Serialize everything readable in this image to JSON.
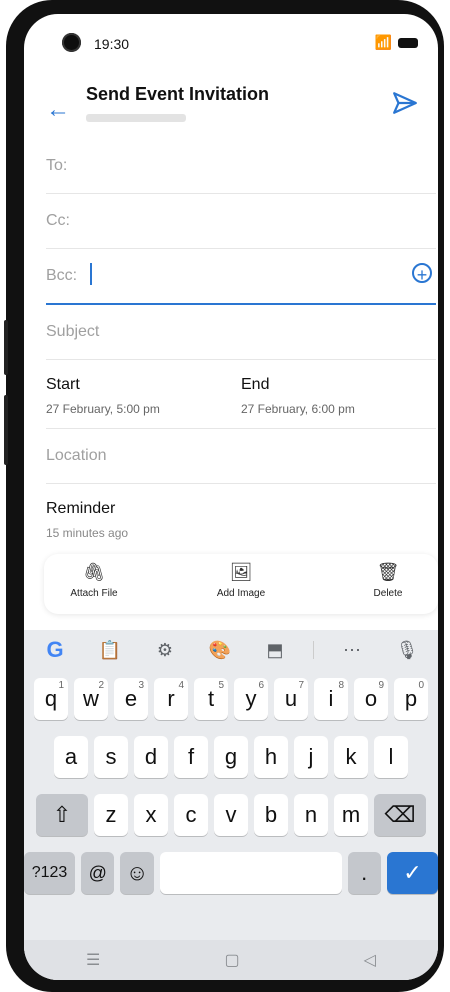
{
  "status": {
    "time": "19:30"
  },
  "header": {
    "title": "Send Event Invitation"
  },
  "form": {
    "to_label": "To:",
    "cc_label": "Cc:",
    "bcc_label": "Bcc:",
    "subject_placeholder": "Subject",
    "start_label": "Start",
    "start_value": "27 February, 5:00 pm",
    "end_label": "End",
    "end_value": "27 February, 6:00 pm",
    "location_placeholder": "Location",
    "reminder_label": "Reminder",
    "reminder_value": "15 minutes ago"
  },
  "actions": {
    "attach": "Attach File",
    "image": "Add Image",
    "delete": "Delete"
  },
  "keyboard": {
    "row1": [
      {
        "char": "q",
        "num": "1"
      },
      {
        "char": "w",
        "num": "2"
      },
      {
        "char": "e",
        "num": "3"
      },
      {
        "char": "r",
        "num": "4"
      },
      {
        "char": "t",
        "num": "5"
      },
      {
        "char": "y",
        "num": "6"
      },
      {
        "char": "u",
        "num": "7"
      },
      {
        "char": "i",
        "num": "8"
      },
      {
        "char": "o",
        "num": "9"
      },
      {
        "char": "p",
        "num": "0"
      }
    ],
    "row2": [
      "a",
      "s",
      "d",
      "f",
      "g",
      "h",
      "j",
      "k",
      "l"
    ],
    "row3": [
      "z",
      "x",
      "c",
      "v",
      "b",
      "n",
      "m"
    ],
    "sym": "?123",
    "at": "@",
    "period": "."
  },
  "colors": {
    "accent": "#2a76d2"
  }
}
